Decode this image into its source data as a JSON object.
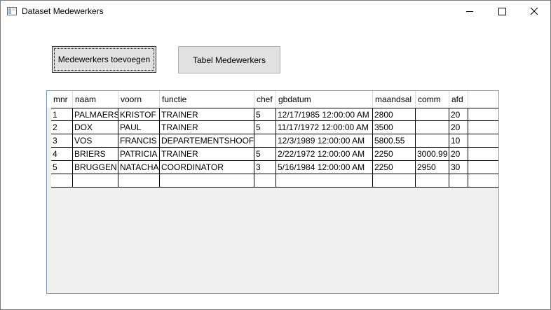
{
  "window": {
    "title": "Dataset Medewerkers"
  },
  "toolbar": {
    "add_label": "Medewerkers toevoegen",
    "table_label": "Tabel Medewerkers"
  },
  "grid": {
    "columns": [
      "mnr",
      "naam",
      "voorn",
      "functie",
      "chef",
      "gbdatum",
      "maandsal",
      "comm",
      "afd"
    ],
    "rows": [
      [
        "1",
        "PALMAERS",
        "KRISTOF",
        "TRAINER",
        "5",
        "12/17/1985 12:00:00 AM",
        "2800",
        "",
        "20"
      ],
      [
        "2",
        "DOX",
        "PAUL",
        "TRAINER",
        "5",
        "11/17/1972 12:00:00 AM",
        "3500",
        "",
        "20"
      ],
      [
        "3",
        "VOS",
        "FRANCIS",
        "DEPARTEMENTSHOOFD",
        "",
        "12/3/1989 12:00:00 AM",
        "5800.55",
        "",
        "10"
      ],
      [
        "4",
        "BRIERS",
        "PATRICIA",
        "TRAINER",
        "5",
        "2/22/1972 12:00:00 AM",
        "2250",
        "3000.99",
        "20"
      ],
      [
        "5",
        "BRUGGEN",
        "NATACHA",
        "COORDINATOR",
        "3",
        "5/16/1984 12:00:00 AM",
        "2250",
        "2950",
        "30"
      ],
      [
        "",
        "",
        "",
        "",
        "",
        "",
        "",
        "",
        ""
      ]
    ]
  },
  "icons": {
    "app": "window-app-icon",
    "minimize": "minimize-icon",
    "maximize": "maximize-icon",
    "close": "close-icon"
  }
}
